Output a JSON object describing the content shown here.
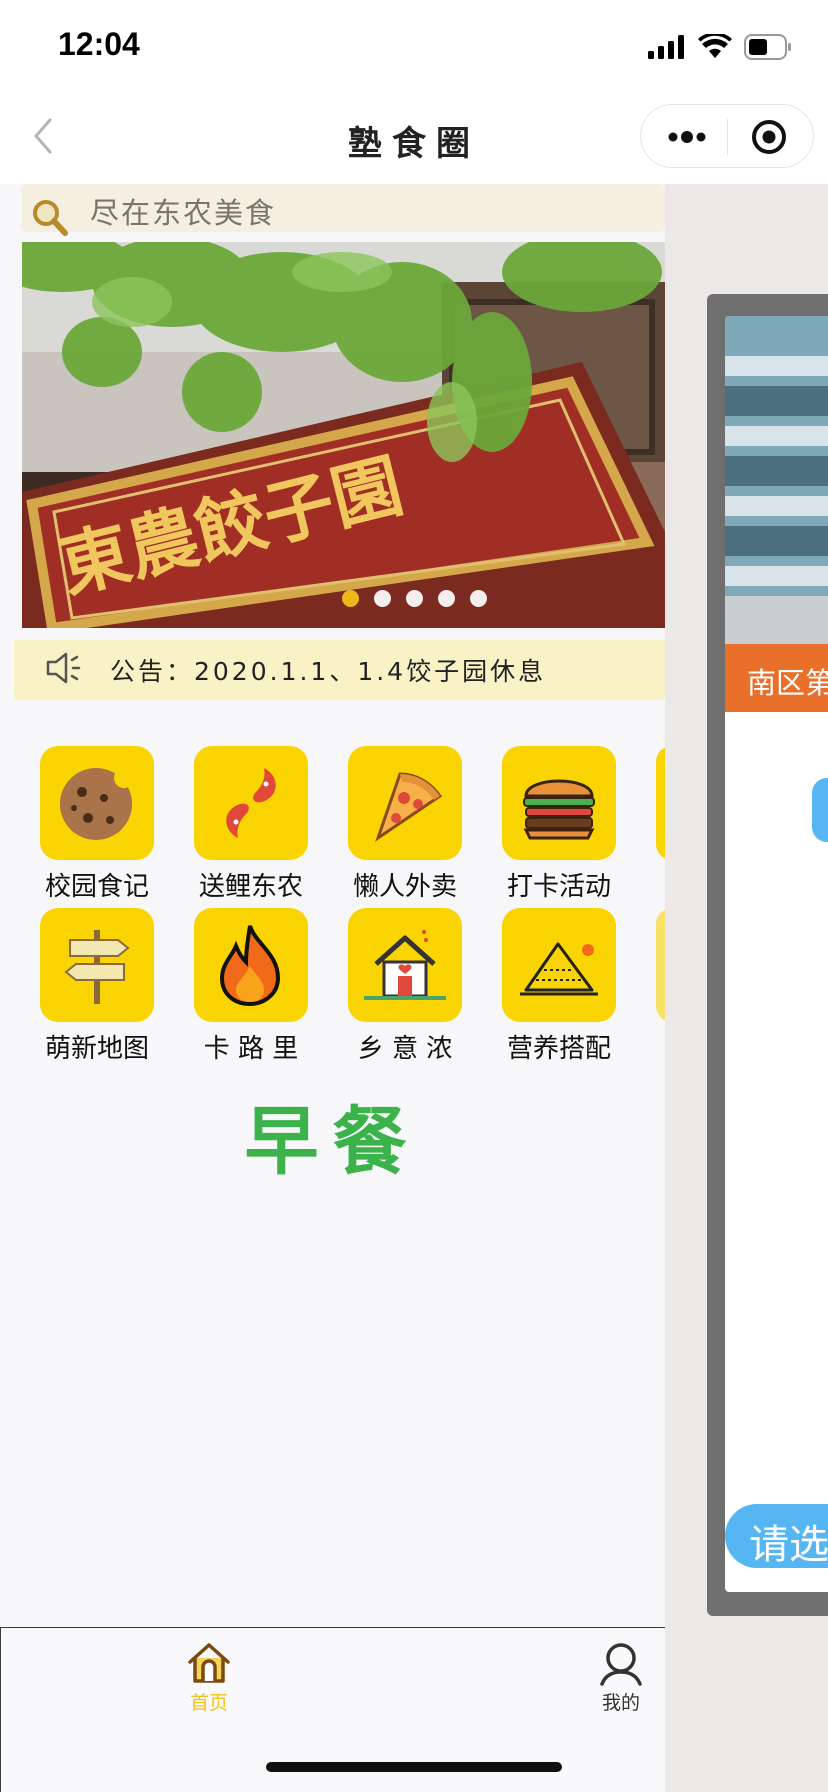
{
  "status_bar": {
    "time": "12:04"
  },
  "nav": {
    "title": "塾食圈"
  },
  "search": {
    "placeholder": "尽在东农美食"
  },
  "banner": {
    "sign_text": "東農餃子園",
    "slide_count": 5,
    "active_slide": 1
  },
  "notice": {
    "text": "公告：2020.1.1、1.4饺子园休息"
  },
  "grid": {
    "items": [
      {
        "label": "校园食记",
        "icon": "cookie-icon"
      },
      {
        "label": "送鲤东农",
        "icon": "koi-fish-icon"
      },
      {
        "label": "懒人外卖",
        "icon": "pizza-icon"
      },
      {
        "label": "打卡活动",
        "icon": "burger-icon"
      },
      {
        "label": "萌新地图",
        "icon": "signpost-icon"
      },
      {
        "label": "卡 路 里",
        "icon": "flame-icon"
      },
      {
        "label": "乡 意 浓",
        "icon": "house-icon"
      },
      {
        "label": "营养搭配",
        "icon": "pyramid-icon"
      }
    ]
  },
  "section": {
    "title": "早餐"
  },
  "tabbar": {
    "home_label": "首页",
    "mine_label": "我的"
  },
  "right_panel": {
    "header_text": "南区第",
    "button_text": "请选"
  },
  "colors": {
    "accent_yellow": "#f9d401",
    "section_green": "#3bb34a",
    "notice_bg": "#f8f2c6",
    "preview_orange": "#e8702a",
    "preview_blue": "#56b6f4"
  }
}
